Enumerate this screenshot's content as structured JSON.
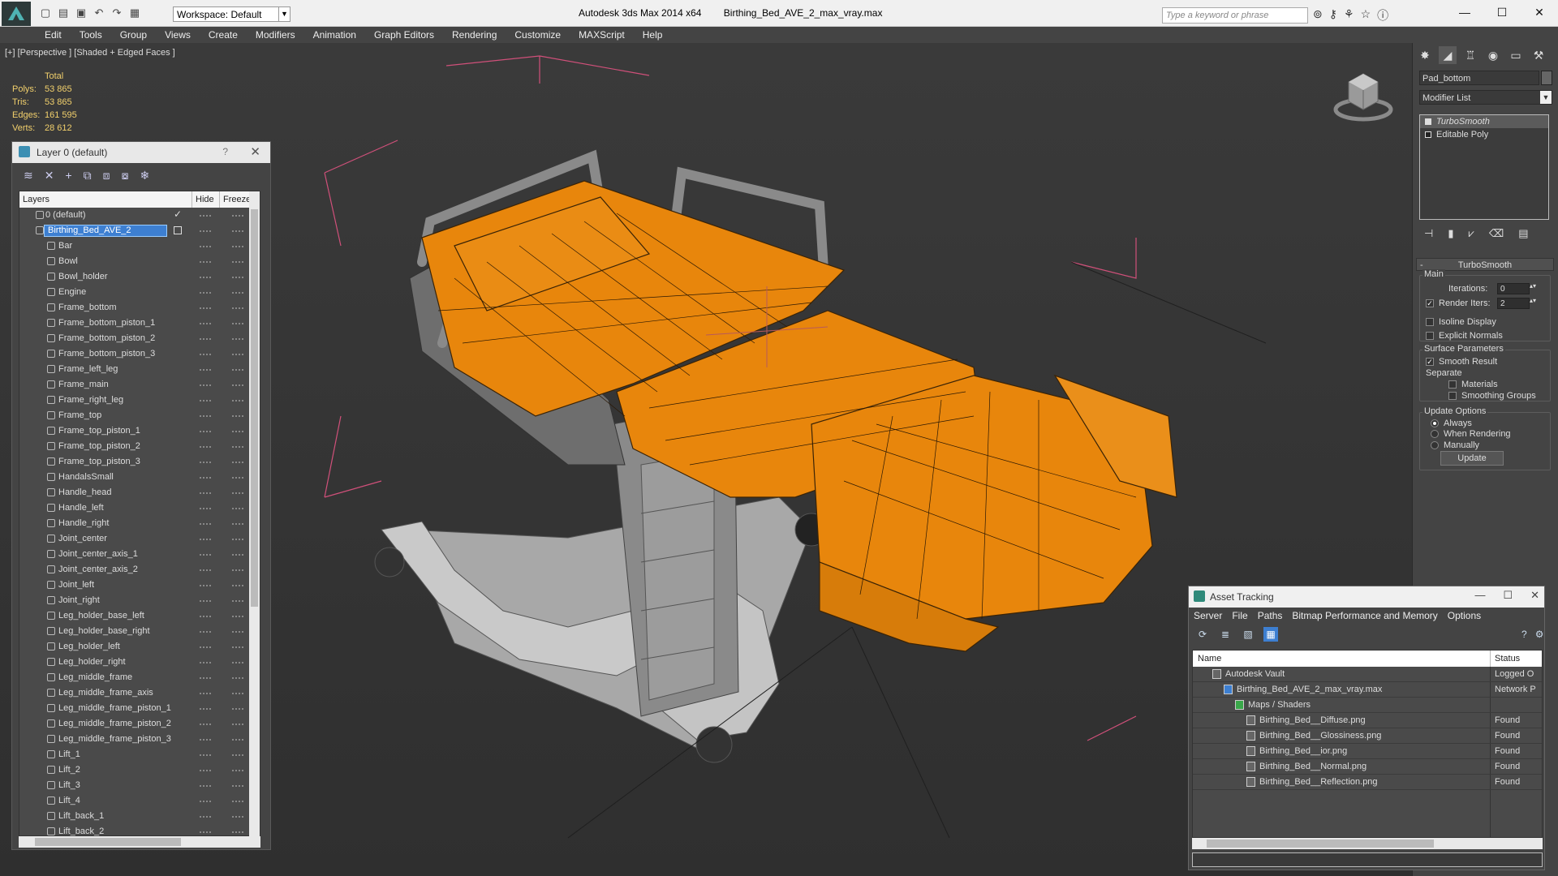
{
  "titlebar": {
    "workspace": "Workspace: Default",
    "app_title": "Autodesk 3ds Max  2014 x64",
    "file_name": "Birthing_Bed_AVE_2_max_vray.max",
    "search_placeholder": "Type a keyword or phrase"
  },
  "menu": [
    "Edit",
    "Tools",
    "Group",
    "Views",
    "Create",
    "Modifiers",
    "Animation",
    "Graph Editors",
    "Rendering",
    "Customize",
    "MAXScript",
    "Help"
  ],
  "viewport": {
    "label": "[+] [Perspective ] [Shaded + Edged Faces ]",
    "stats": {
      "header": "Total",
      "polys_label": "Polys:",
      "polys": "53 865",
      "tris_label": "Tris:",
      "tris": "53 865",
      "edges_label": "Edges:",
      "edges": "161 595",
      "verts_label": "Verts:",
      "verts": "28 612"
    },
    "colors": {
      "mesh": "#e8860c",
      "frame": "#9a9a9a",
      "bbox": "#d0507a"
    }
  },
  "layers": {
    "title": "Layer 0 (default)",
    "help": "?",
    "col_layers": "Layers",
    "col_hide": "Hide",
    "col_freeze": "Freeze",
    "default_layer": "0 (default)",
    "selected_layer": "Birthing_Bed_AVE_2",
    "items": [
      "Bar",
      "Bowl",
      "Bowl_holder",
      "Engine",
      "Frame_bottom",
      "Frame_bottom_piston_1",
      "Frame_bottom_piston_2",
      "Frame_bottom_piston_3",
      "Frame_left_leg",
      "Frame_main",
      "Frame_right_leg",
      "Frame_top",
      "Frame_top_piston_1",
      "Frame_top_piston_2",
      "Frame_top_piston_3",
      "HandalsSmall",
      "Handle_head",
      "Handle_left",
      "Handle_right",
      "Joint_center",
      "Joint_center_axis_1",
      "Joint_center_axis_2",
      "Joint_left",
      "Joint_right",
      "Leg_holder_base_left",
      "Leg_holder_base_right",
      "Leg_holder_left",
      "Leg_holder_right",
      "Leg_middle_frame",
      "Leg_middle_frame_axis",
      "Leg_middle_frame_piston_1",
      "Leg_middle_frame_piston_2",
      "Leg_middle_frame_piston_3",
      "Lift_1",
      "Lift_2",
      "Lift_3",
      "Lift_4",
      "Lift_back_1",
      "Lift_back_2"
    ]
  },
  "command_panel": {
    "object_name": "Pad_bottom",
    "modifier_list": "Modifier List",
    "stack": [
      "TurboSmooth",
      "Editable Poly"
    ],
    "rollout": "TurboSmooth",
    "main": "Main",
    "iterations_label": "Iterations:",
    "iterations": "0",
    "render_iters_label": "Render Iters:",
    "render_iters": "2",
    "isoline": "Isoline Display",
    "explicit_normals": "Explicit Normals",
    "surface_params": "Surface Parameters",
    "smooth_result": "Smooth Result",
    "separate": "Separate",
    "materials": "Materials",
    "smoothing_groups": "Smoothing Groups",
    "update_options": "Update Options",
    "always": "Always",
    "when_rendering": "When Rendering",
    "manually": "Manually",
    "update_btn": "Update"
  },
  "assets": {
    "title": "Asset Tracking",
    "menu": [
      "Server",
      "File",
      "Paths",
      "Bitmap Performance and Memory",
      "Options"
    ],
    "col_name": "Name",
    "col_status": "Status",
    "rows": [
      {
        "name": "Autodesk Vault",
        "status": "Logged O"
      },
      {
        "name": "Birthing_Bed_AVE_2_max_vray.max",
        "status": "Network P"
      },
      {
        "name": "Maps / Shaders",
        "status": ""
      },
      {
        "name": "Birthing_Bed__Diffuse.png",
        "status": "Found"
      },
      {
        "name": "Birthing_Bed__Glossiness.png",
        "status": "Found"
      },
      {
        "name": "Birthing_Bed__ior.png",
        "status": "Found"
      },
      {
        "name": "Birthing_Bed__Normal.png",
        "status": "Found"
      },
      {
        "name": "Birthing_Bed__Reflection.png",
        "status": "Found"
      }
    ]
  }
}
